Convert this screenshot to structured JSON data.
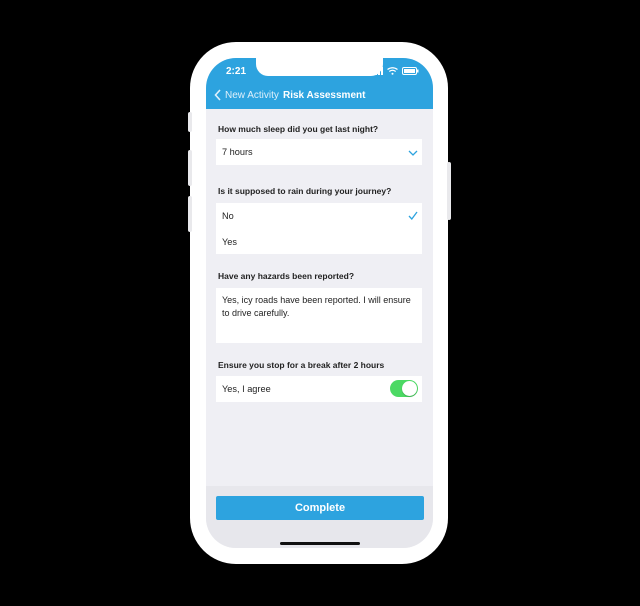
{
  "status_bar": {
    "time": "2:21"
  },
  "nav": {
    "back_label": "New Activity",
    "title": "Risk Assessment"
  },
  "questions": {
    "sleep": {
      "label": "How much sleep did you get last night?",
      "value": "7 hours"
    },
    "rain": {
      "label": "Is it supposed to rain during your journey?",
      "options": [
        "No",
        "Yes"
      ],
      "selected": "No"
    },
    "hazards": {
      "label": "Have any hazards been reported?",
      "text_line1": "Yes, icy roads have been reported. I will ensure",
      "text_line2": "to drive carefully."
    },
    "break": {
      "label": "Ensure you stop for a break after 2 hours",
      "toggle_label": "Yes, I agree",
      "toggle_on": true
    }
  },
  "footer": {
    "complete_label": "Complete"
  },
  "colors": {
    "accent": "#2da3df",
    "toggle_on": "#4cd964",
    "background": "#efeff4"
  }
}
